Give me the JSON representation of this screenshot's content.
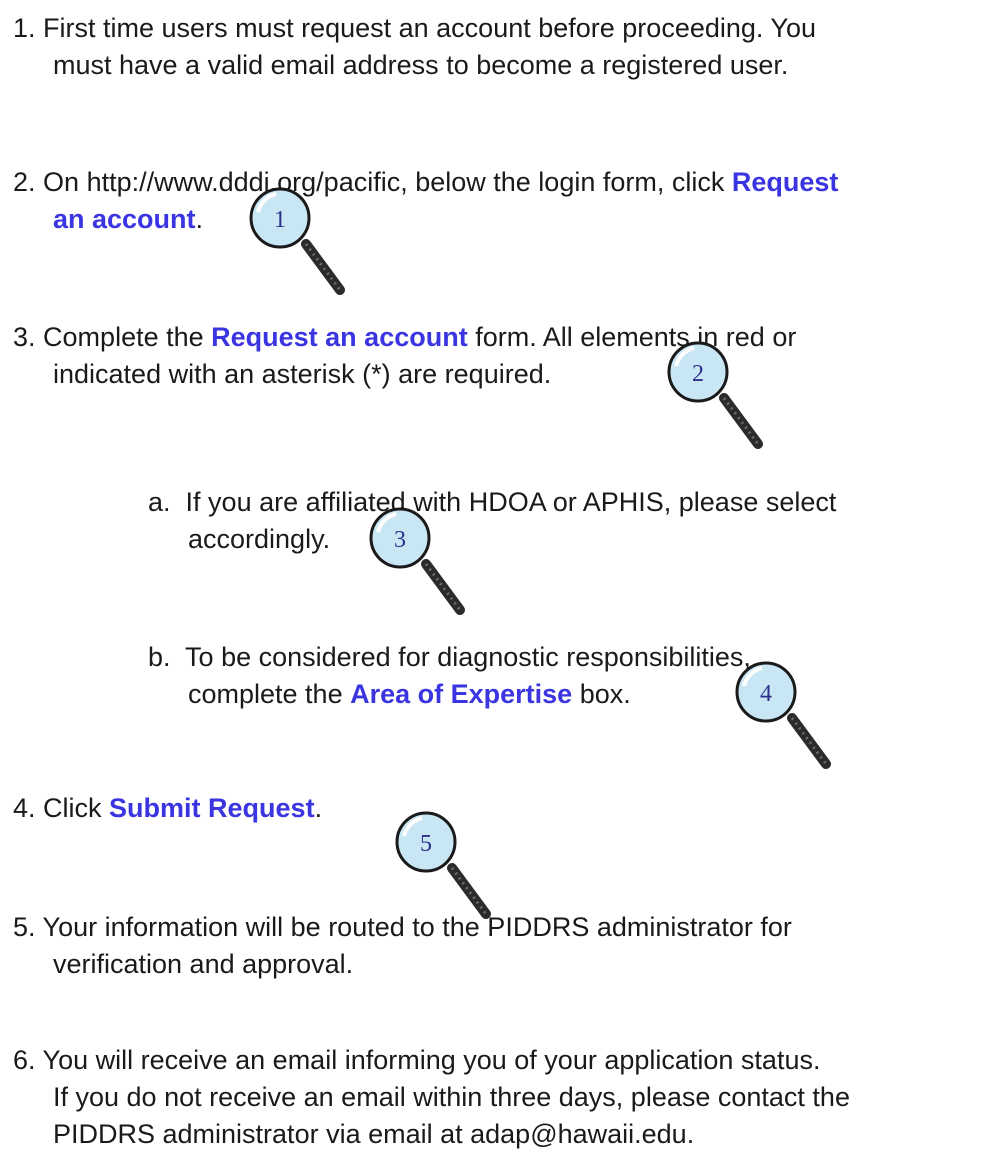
{
  "steps": [
    {
      "num": "1.",
      "line1": "First time users must request an account before proceeding.  You",
      "line2": "must have a valid email address to become a registered user."
    },
    {
      "num": "2.",
      "pre": "On http://www.dddi.org/pacific, below the login form, click ",
      "link_a": "Request",
      "link_b": "an account",
      "post": "."
    },
    {
      "num": "3.",
      "pre": "Complete the ",
      "link": "Request an account",
      "post": " form.  All elements in red or",
      "line2": "indicated with an asterisk (*) are required."
    },
    {
      "num": "a.",
      "line1": "If you are affiliated with HDOA or APHIS, please select",
      "line2": "accordingly."
    },
    {
      "num": "b.",
      "line1": "To be considered for diagnostic responsibilities,",
      "pre": "complete the ",
      "link": "Area of Expertise",
      "post": " box."
    },
    {
      "num": "4.",
      "pre": "Click ",
      "link": "Submit Request",
      "post": "."
    },
    {
      "num": "5.",
      "line1": "Your information will be routed to the PIDDRS administrator for",
      "line2": "verification and approval."
    },
    {
      "num": "6.",
      "line1": "You will receive an email informing you of your application status.",
      "line2": "If you do not receive an email within three days, please contact the",
      "line3": "PIDDRS administrator via email at adap@hawaii.edu."
    }
  ],
  "magnifiers": [
    "1",
    "2",
    "3",
    "4",
    "5"
  ],
  "colors": {
    "link": "#3a35e0",
    "text": "#1a1a1a",
    "lens_rim": "#1a1a1a",
    "lens_fill": "#c9e6f5",
    "handle": "#2b2b2b"
  },
  "icons": {
    "magnifier": "magnifying-glass-icon"
  }
}
